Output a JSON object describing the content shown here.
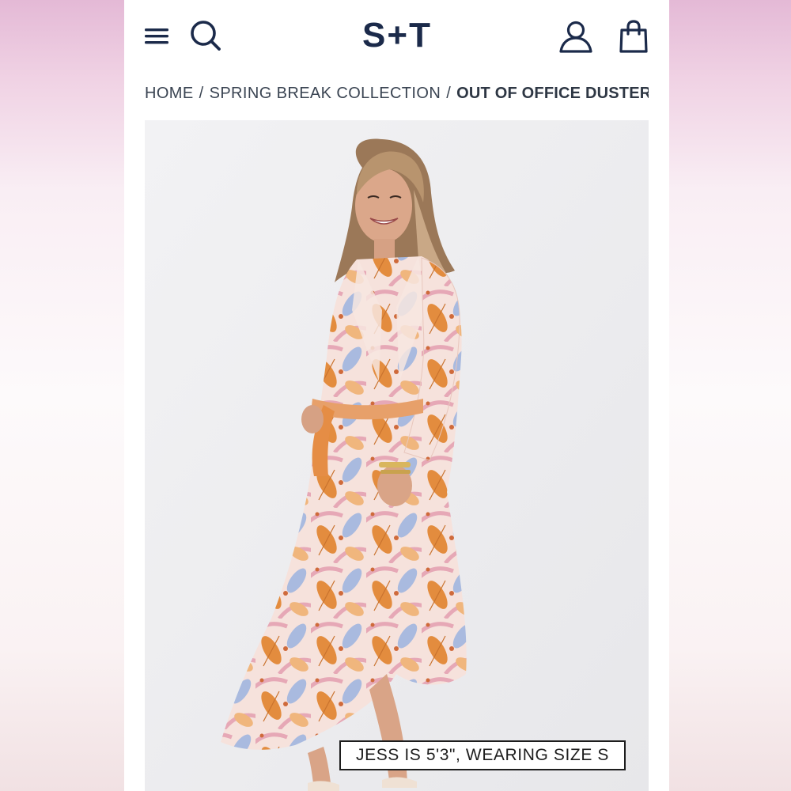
{
  "header": {
    "logo_text": "S+T",
    "menu_icon": "hamburger-menu-icon",
    "search_icon": "search-icon",
    "account_icon": "user-account-icon",
    "bag_icon": "shopping-bag-icon",
    "brand_color": "#1b2a4a"
  },
  "breadcrumb": {
    "items": [
      "HOME",
      "SPRING BREAK COLLECTION"
    ],
    "separator": "/",
    "current": "OUT OF OFFICE DUSTER IN TROPI"
  },
  "product": {
    "model_caption": "JESS IS 5'3\", WEARING SIZE S",
    "print_colors": [
      "#e08a3c",
      "#a9b9de",
      "#f2c6b4",
      "#d98aa0"
    ]
  }
}
